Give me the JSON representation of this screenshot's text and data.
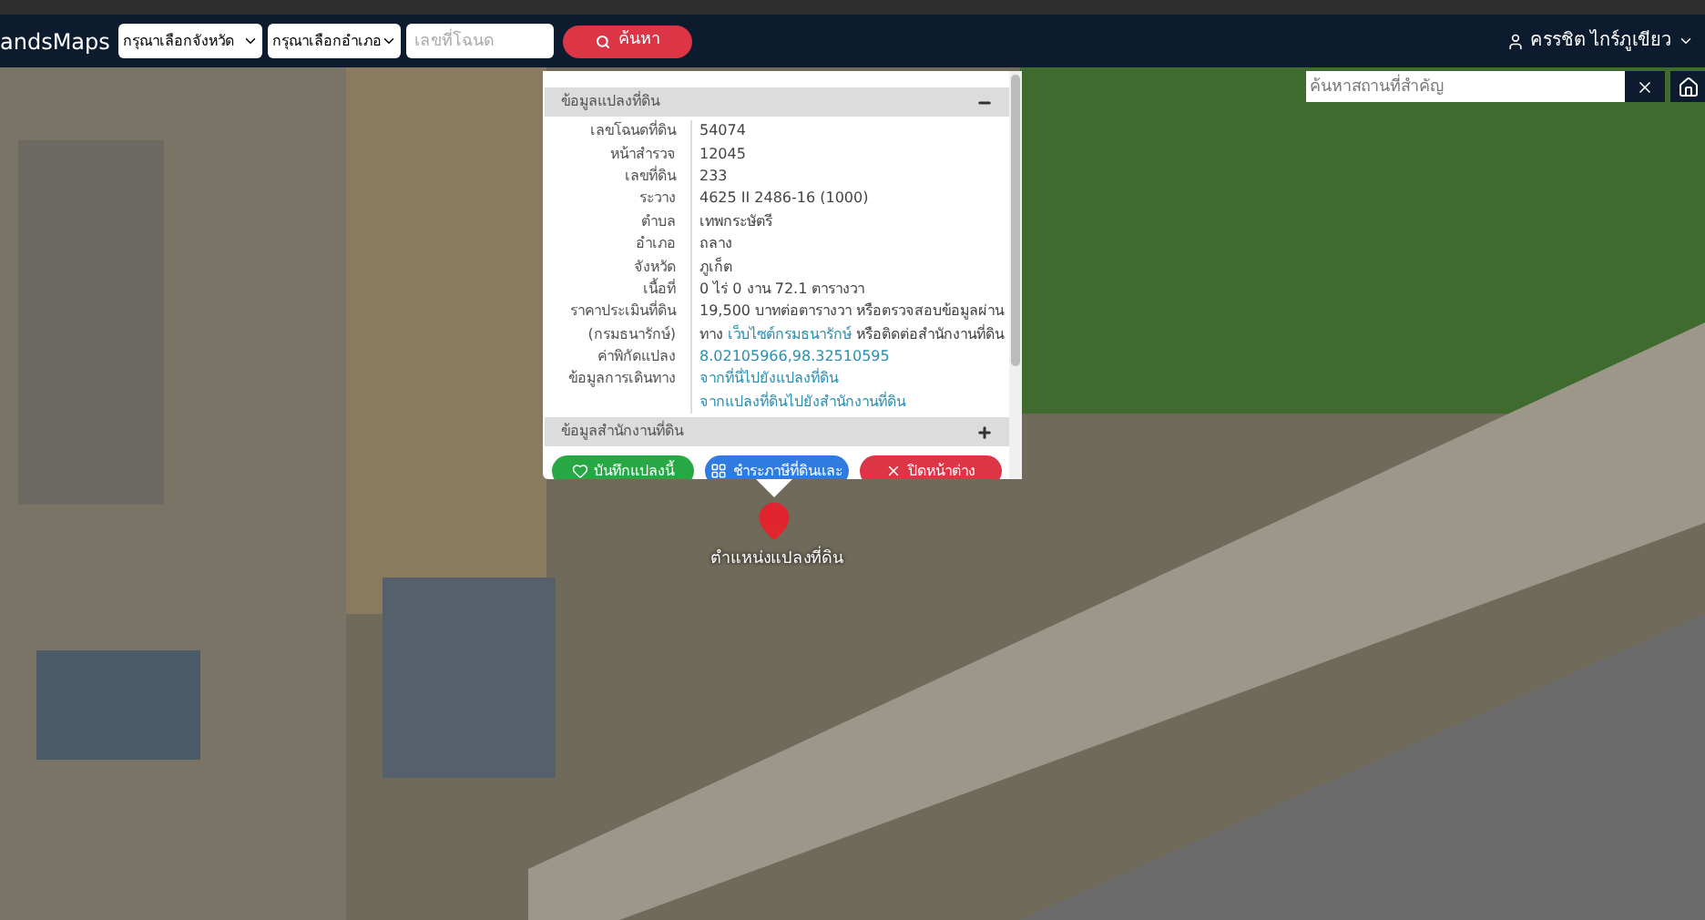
{
  "navbar": {
    "brand": "andsMaps",
    "province_select": "กรุณาเลือกจังหวัด",
    "district_select": "กรุณาเลือกอำเภอ",
    "deed_input": {
      "placeholder": "เลขที่โฉนด"
    },
    "search_button": "ค้นหา",
    "user": "ครรชิต ไกร์ภูเขียว"
  },
  "place_search": {
    "placeholder": "ค้นหาสถานที่สำคัญ"
  },
  "popup": {
    "sections": [
      {
        "title": "ข้อมูลแปลงที่ดิน",
        "expanded": true,
        "rows": [
          {
            "label": "เลขโฉนดที่ดิน",
            "parts": [
              {
                "kind": "text",
                "text": "54074"
              }
            ]
          },
          {
            "label": "หน้าสำรวจ",
            "parts": [
              {
                "kind": "text",
                "text": "12045"
              }
            ]
          },
          {
            "label": "เลขที่ดิน",
            "parts": [
              {
                "kind": "text",
                "text": "233"
              }
            ]
          },
          {
            "label": "ระวาง",
            "parts": [
              {
                "kind": "text",
                "text": "4625 II 2486-16 (1000)"
              }
            ]
          },
          {
            "label": "ตำบล",
            "parts": [
              {
                "kind": "text",
                "text": "เทพกระษัตรี"
              }
            ]
          },
          {
            "label": "อำเภอ",
            "parts": [
              {
                "kind": "text",
                "text": "ถลาง"
              }
            ]
          },
          {
            "label": "จังหวัด",
            "parts": [
              {
                "kind": "text",
                "text": "ภูเก็ต"
              }
            ]
          },
          {
            "label": "เนื้อที่",
            "parts": [
              {
                "kind": "text",
                "text": "0 ไร่ 0 งาน 72.1 ตารางวา"
              }
            ]
          },
          {
            "label": "ราคาประเมินที่ดิน",
            "parts": [
              {
                "kind": "text",
                "text": "19,500 บาทต่อตารางวา หรือตรวจสอบข้อมูลผ่าน"
              }
            ]
          },
          {
            "label": "(กรมธนารักษ์)",
            "parts": [
              {
                "kind": "text",
                "text": "ทาง "
              },
              {
                "kind": "link",
                "text": "เว็บไซต์กรมธนารักษ์"
              },
              {
                "kind": "text",
                "text": " หรือติดต่อสำนักงานที่ดิน"
              }
            ]
          },
          {
            "label": "ค่าพิกัดแปลง",
            "parts": [
              {
                "kind": "link",
                "text": "8.02105966,98.32510595"
              }
            ]
          },
          {
            "label": "ข้อมูลการเดินทาง",
            "parts": [
              {
                "kind": "link",
                "text": "จากที่นี่ไปยังแปลงที่ดิน"
              }
            ]
          },
          {
            "parts": [
              {
                "kind": "link",
                "text": "จากแปลงที่ดินไปยังสำนักงานที่ดิน"
              }
            ]
          }
        ]
      },
      {
        "title": "ข้อมูลสำนักงานที่ดิน",
        "expanded": false
      }
    ],
    "buttons": [
      {
        "kind": "save",
        "label": "บันทึกแปลงนี้"
      },
      {
        "kind": "tax",
        "label": "ชำระภาษีที่ดินและ"
      },
      {
        "kind": "close",
        "label": "ปิดหน้าต่าง"
      }
    ]
  },
  "marker": {
    "label": "ตำแหน่งแปลงที่ดิน"
  }
}
